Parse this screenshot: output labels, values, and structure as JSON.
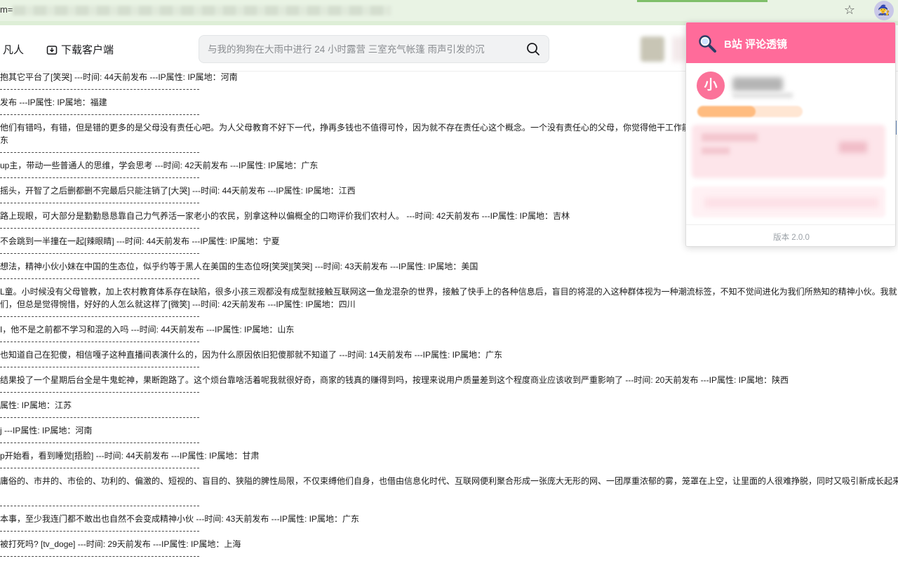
{
  "browser": {
    "url_prefix": "m=",
    "bookmark_icon": "star-icon",
    "extension_icon": "wizard-icon"
  },
  "header": {
    "nav_fanren": "凡人",
    "download_label": "下载客户端",
    "search_placeholder": "与我的狗狗在大雨中进行 24 小时露营 三室充气帐篷 雨声引发的沉"
  },
  "comments": [
    {
      "text": "抱其它平台了[笑哭] ---时间: 44天前发布 ---IP属性: IP属地：河南"
    },
    {
      "text": "发布 ---IP属性: IP属地：福建"
    },
    {
      "text": "他们有错吗，有错，但是错的更多的是父母没有责任心吧。为人父母教育不好下一代，挣再多钱也不值得可怜，因为就不存在责任心这个概念。一个没有责任心的父母，你觉得他干工作能",
      "text2": "东"
    },
    {
      "text": "up主，带动一些普通人的思维，学会思考 ---时间: 42天前发布 ---IP属性: IP属地：广东"
    },
    {
      "text": "摇头，开智了之后删都删不完最后只能注销了[大哭] ---时间: 44天前发布 ---IP属性: IP属地：江西"
    },
    {
      "text": "路上现眼，可大部分是勤勤恳恳靠自己力气养活一家老小的农民，别拿这种以偏概全的口吻评价我们农村人。 ---时间: 42天前发布 ---IP属性: IP属地：吉林"
    },
    {
      "text": "不会跳到一半撞在一起[辣眼睛] ---时间: 44天前发布 ---IP属性: IP属地：宁夏"
    },
    {
      "text": "想法，精神小伙小妹在中国的生态位，似乎约等于黑人在美国的生态位呀[笑哭][笑哭] ---时间: 43天前发布 ---IP属性: IP属地：美国"
    },
    {
      "text": "L童。小时候没有父母管教，加上农村教育体系存在缺陷，很多小孩三观都没有成型就接触互联网这一鱼龙混杂的世界，接触了快手上的各种信息后，盲目的将混的入这种群体视为一种潮流标签，不知不觉间进化为我们所熟知的精神小伙。我就",
      "text2": "们，但总是觉得惋惜，好好的人怎么就这样了[微笑] ---时间: 42天前发布 ---IP属性: IP属地：四川"
    },
    {
      "text": "I，他不是之前都不学习和混的入吗 ---时间: 44天前发布 ---IP属性: IP属地：山东"
    },
    {
      "text": "也知道自己在犯傻，相信嘎子这种直播间表演什么的，因为什么原因依旧犯傻那就不知道了 ---时间: 14天前发布 ---IP属性: IP属地：广东"
    },
    {
      "text": "结果投了一个星期后台全是牛鬼蛇神，果断跑路了。这个烦台靠啥活着呢我就很好奇，商家的钱真的赚得到吗，按理来说用户质量差到这个程度商业应该收到严重影响了 ---时间: 20天前发布 ---IP属性: IP属地：陕西"
    },
    {
      "text": "属性: IP属地：江苏"
    },
    {
      "text": "j ---IP属性: IP属地：河南"
    },
    {
      "text": "p开始看，看到睡觉[捂脸] ---时间: 44天前发布 ---IP属性: IP属地：甘肃"
    },
    {
      "text": "庸俗的、市井的、市侩的、功利的、偏激的、短视的、盲目的、狭隘的脾性局限，不仅束缚他们自身，也借由信息化时代、互联网便利聚合形成一张庞大无形的网、一团厚重浓郁的雾，笼罩在上空，让里面的人很难挣脱，同时又吸引新成长起来"
    },
    {
      "text": "本事，至少我连门都不敢出也自然不会变成精神小伙 ---时间: 43天前发布 ---IP属性: IP属地：广东"
    },
    {
      "text": "被打死吗? [tv_doge] ---时间: 29天前发布 ---IP属性: IP属地：上海"
    }
  ],
  "popup": {
    "title": "B站 评论透镜",
    "avatar_char": "小",
    "level_fraction": 0.55,
    "version": "版本 2.0.0"
  },
  "colors": {
    "popup_header": "#ff6b9a",
    "avatar": "#fb7299",
    "chrome_bar": "#e9f3e4"
  }
}
